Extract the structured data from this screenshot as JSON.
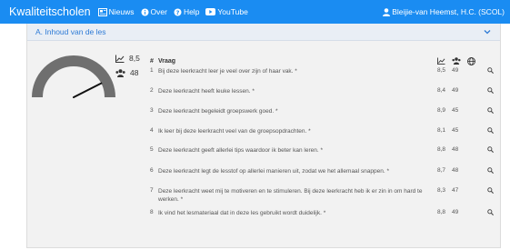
{
  "navbar": {
    "brand": "Kwaliteitscholen",
    "items": [
      {
        "label": "Nieuws",
        "icon": "newspaper-icon"
      },
      {
        "label": "Over",
        "icon": "info-icon"
      },
      {
        "label": "Help",
        "icon": "help-icon"
      },
      {
        "label": "YouTube",
        "icon": "youtube-icon"
      }
    ],
    "user": "Bleijie-van Heemst, H.C. (SCOL)"
  },
  "panel": {
    "title": "A. Inhoud van de les",
    "score": "8,5",
    "respondents": "48",
    "gauge_score_fraction": 0.85
  },
  "table": {
    "header": {
      "num": "#",
      "question": "Vraag"
    },
    "rows": [
      {
        "num": "1",
        "question": "Bij deze leerkracht leer je veel over zijn of haar vak. *",
        "score": "8,5",
        "resp": "49"
      },
      {
        "num": "2",
        "question": "Deze leerkracht heeft leuke lessen. *",
        "score": "8,4",
        "resp": "49"
      },
      {
        "num": "3",
        "question": "Deze leerkracht begeleidt groepswerk goed. *",
        "score": "8,9",
        "resp": "45"
      },
      {
        "num": "4",
        "question": "Ik leer bij deze leerkracht veel van de groepsopdrachten. *",
        "score": "8,1",
        "resp": "45"
      },
      {
        "num": "5",
        "question": "Deze leerkracht geeft allerlei tips waardoor ik beter kan leren. *",
        "score": "8,8",
        "resp": "48"
      },
      {
        "num": "6",
        "question": "Deze leerkracht legt de lesstof op allerlei manieren uit, zodat we het allemaal snappen. *",
        "score": "8,7",
        "resp": "48"
      },
      {
        "num": "7",
        "question": "Deze leerkracht weet mij te motiveren en te stimuleren. Bij deze leerkracht heb ik er zin in om hard te werken. *",
        "score": "8,3",
        "resp": "47"
      },
      {
        "num": "8",
        "question": "Ik vind het lesmateriaal dat in deze les gebruikt wordt duidelijk. *",
        "score": "8,8",
        "resp": "49"
      }
    ]
  },
  "colors": {
    "navbar": "#1a8cf2",
    "accent": "#2e7bd6",
    "gauge": "#6f6f6f"
  }
}
